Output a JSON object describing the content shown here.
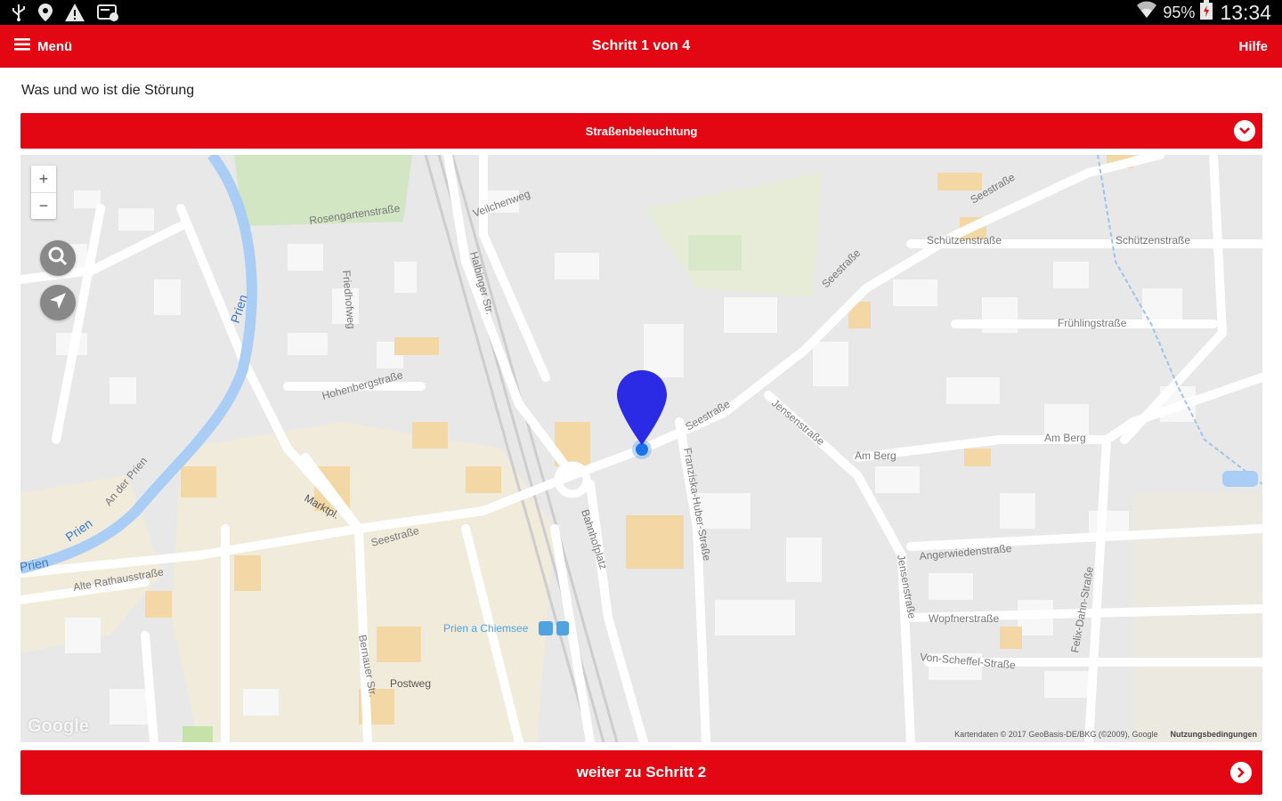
{
  "statusbar": {
    "icons": [
      "usb-icon",
      "location-icon",
      "warning-icon",
      "cast-icon",
      "wifi-icon",
      "battery-icon"
    ],
    "battery": "95%",
    "time": "13:34"
  },
  "appbar": {
    "menu_label": "Menü",
    "title": "Schritt 1 von 4",
    "help_label": "Hilfe",
    "color": "#e30613"
  },
  "form": {
    "prompt": "Was und wo ist die Störung",
    "category_selected": "Straßenbeleuchtung"
  },
  "map": {
    "zoom_in": "+",
    "zoom_out": "−",
    "marker_color": "#2b2be6",
    "labels": {
      "prien": "Prien",
      "prien_river2": "Prien",
      "prien_river3": "Prien",
      "seestrasse1": "Seestraße",
      "seestrasse2": "Seestraße",
      "seestrasse3": "Seestraße",
      "seestrasse4": "Seestraße",
      "schuetzenstrasse1": "Schützenstraße",
      "schuetzenstrasse2": "Schützenstraße",
      "fruehlingstrasse": "Frühlingstraße",
      "jensenstrasse1": "Jensenstraße",
      "jensenstrasse2": "Jensenstraße",
      "am_berg1": "Am Berg",
      "am_berg2": "Am Berg",
      "hohenbergstrasse": "Hohenbergstraße",
      "marktpl": "Marktpl.",
      "alte_rathausstrasse": "Alte Rathausstraße",
      "angerwiedenstrasse": "Angerwiedenstraße",
      "wopfnerstrasse": "Wopfnerstraße",
      "von_scheffel": "Von-Scheffel-Straße",
      "felix_dahn": "Felix-Dahn-Straße",
      "station": "Prien a Chiemsee",
      "postweg": "Postweg",
      "an_der_prien": "An der Prien",
      "halbinger": "Halbinger Str.",
      "veilchenweg": "Veilchenweg",
      "rosengartenstrasse": "Rosengartenstraße",
      "bahnhofplatz": "Bahnhofplatz",
      "franziska": "Franziska-Huber-Straße",
      "bernauer": "Bernauer Str.",
      "friedhofweg": "Friedhofweg"
    },
    "google": "Google",
    "attribution": "Kartendaten © 2017 GeoBasis-DE/BKG (©2009), Google",
    "terms": "Nutzungsbedingungen"
  },
  "next_button": "weiter zu Schritt 2"
}
